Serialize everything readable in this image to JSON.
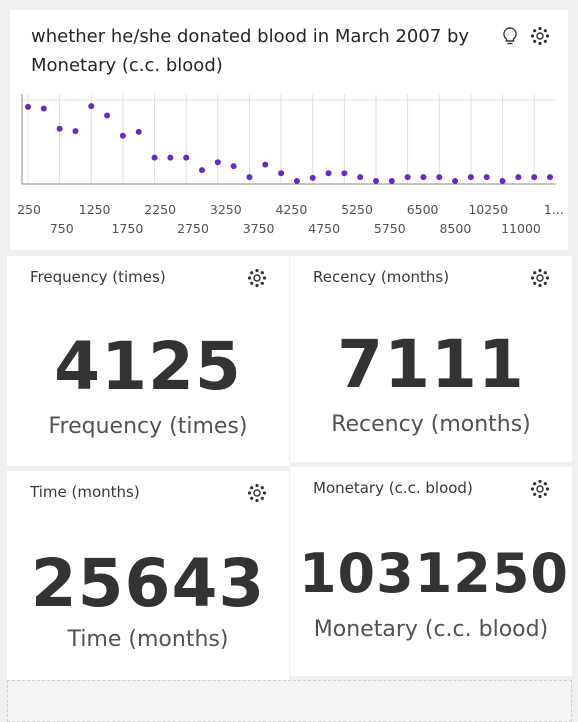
{
  "chart": {
    "title": "whether he/she donated blood in March 2007 by Monetary (c.c. blood)",
    "icons": [
      "lightbulb-icon",
      "settings-icon"
    ]
  },
  "chart_data": {
    "type": "scatter",
    "title": "whether he/she donated blood in March 2007 by Monetary (c.c. blood)",
    "x_tick_labels_row1": [
      "250",
      "1250",
      "2250",
      "3250",
      "4250",
      "5250",
      "6500",
      "10250",
      "1..."
    ],
    "x_tick_labels_row2": [
      "750",
      "1750",
      "2750",
      "3750",
      "4750",
      "5750",
      "8500",
      "11000"
    ],
    "categories": [
      "250",
      "500",
      "750",
      "1000",
      "1250",
      "1500",
      "1750",
      "2000",
      "2250",
      "2500",
      "2750",
      "3000",
      "3250",
      "3500",
      "3750",
      "4000",
      "4250",
      "4500",
      "4750",
      "5000",
      "5250",
      "5500",
      "5750",
      "6000",
      "6250",
      "6500",
      "7000",
      "7500",
      "8500",
      "9500",
      "10250",
      "10500",
      "11000",
      "12500"
    ],
    "values": [
      0.95,
      0.93,
      0.67,
      0.64,
      0.96,
      0.84,
      0.58,
      0.63,
      0.3,
      0.3,
      0.3,
      0.14,
      0.24,
      0.19,
      0.05,
      0.21,
      0.1,
      0.0,
      0.04,
      0.1,
      0.1,
      0.05,
      0.0,
      0.0,
      0.05,
      0.05,
      0.05,
      0.0,
      0.05,
      0.05,
      0.0,
      0.05,
      0.05,
      0.05
    ],
    "ylim": [
      0,
      1
    ],
    "grid": true,
    "color": "#6929c4"
  },
  "kpis": [
    {
      "header": "Frequency (times)",
      "value": "4125",
      "label": "Frequency (times)"
    },
    {
      "header": "Recency (months)",
      "value": "7111",
      "label": "Recency (months)"
    },
    {
      "header": "Time (months)",
      "value": "25643",
      "label": "Time (months)"
    },
    {
      "header": "Monetary (c.c. blood)",
      "value": "1031250",
      "label": "Monetary (c.c. blood)"
    }
  ]
}
